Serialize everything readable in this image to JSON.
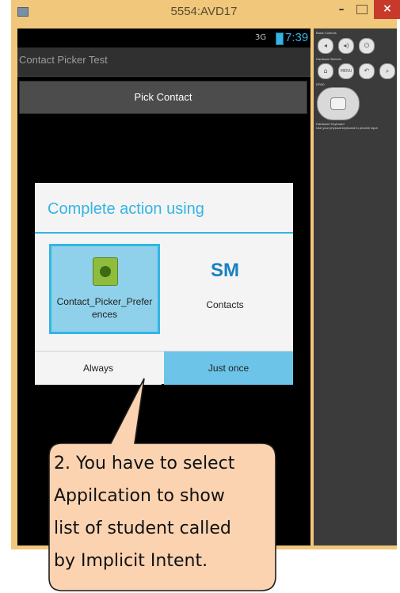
{
  "window": {
    "title": "5554:AVD17",
    "minimize_symbol": "–",
    "close_symbol": "×"
  },
  "statusbar": {
    "signal": "3G",
    "time": "7:39",
    "accent_color": "#33b5e5"
  },
  "app": {
    "title": "Contact Picker Test",
    "pick_button_label": "Pick Contact"
  },
  "dialog": {
    "title": "Complete action using",
    "choices": [
      {
        "label": "Contact_Picker_Preferences",
        "icon": "android-app-icon",
        "selected": true
      },
      {
        "label": "Contacts",
        "icon_text": "SM",
        "selected": false
      }
    ],
    "always_label": "Always",
    "just_once_label": "Just once"
  },
  "emulator_controls": {
    "basic_controls_label": "Basic Controls",
    "hardware_buttons_label": "Hardware Buttons",
    "dpad_label": "DPAD",
    "keyboard_label": "Hardware Keyboard",
    "keyboard_hint": "Use your physical keyboard to provide input",
    "menu_label": "MENU"
  },
  "callout": {
    "text_lines": [
      "2. You have to select",
      "Appilcation to show",
      "list of student called",
      "by Implicit Intent."
    ],
    "fill_color": "#fbd3b1"
  }
}
